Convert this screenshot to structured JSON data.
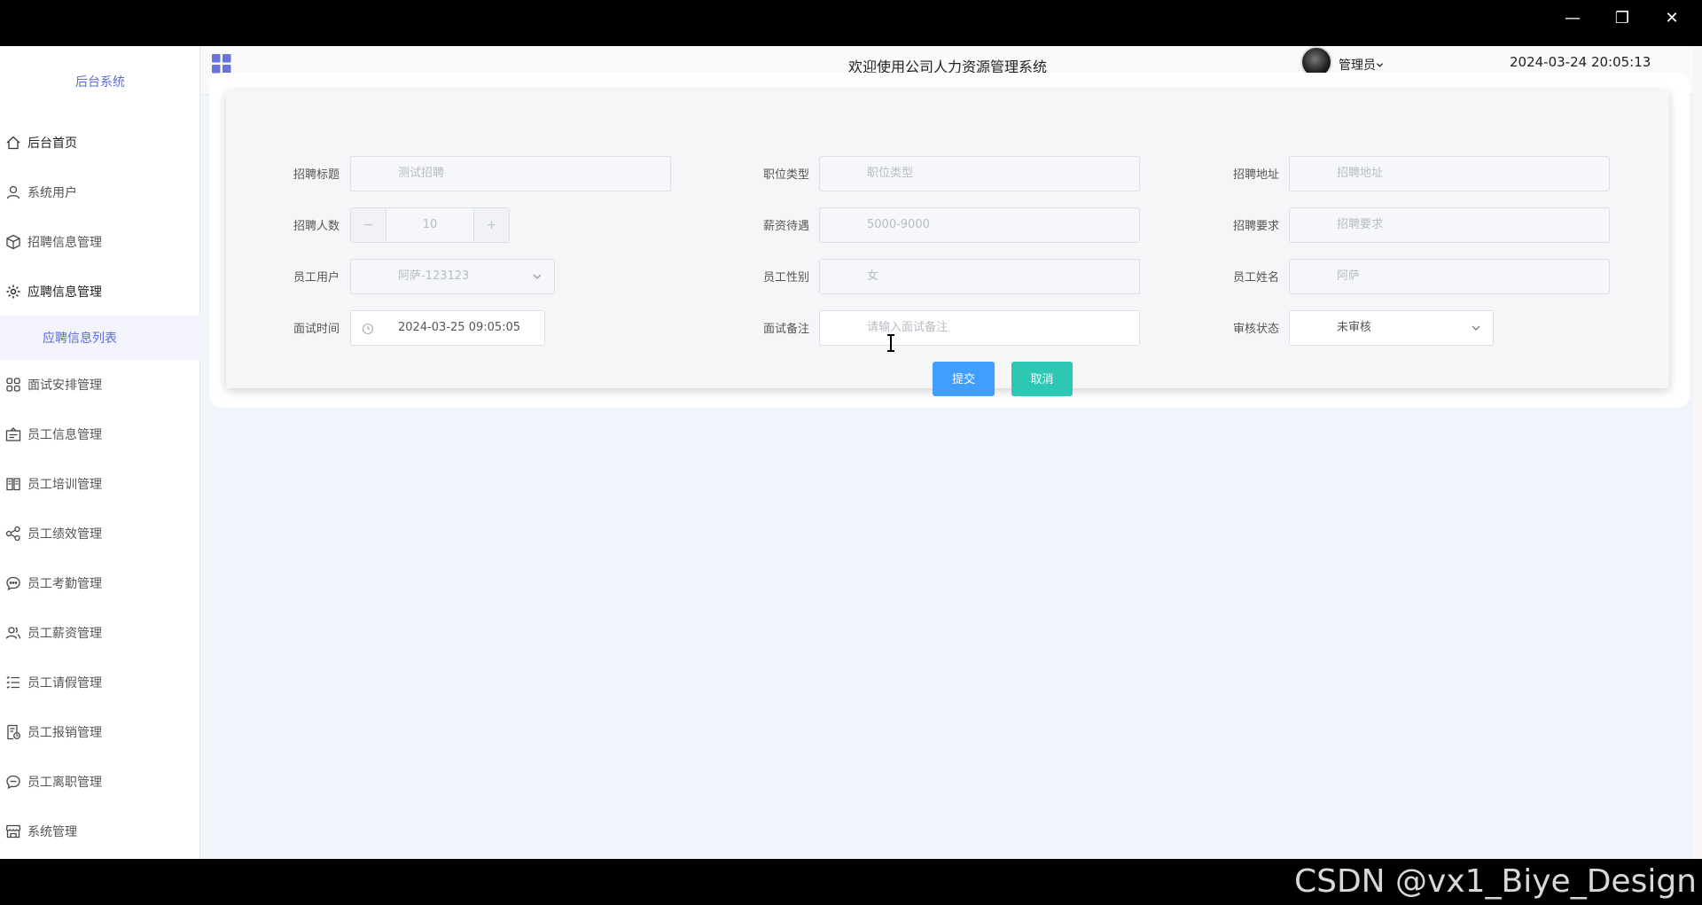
{
  "window": {
    "minimize": "—",
    "maximize": "❐",
    "close": "✕"
  },
  "sidebar": {
    "brand": "后台系统",
    "items": [
      {
        "label": "后台首页",
        "icon": "home-icon"
      },
      {
        "label": "系统用户",
        "icon": "user-icon"
      },
      {
        "label": "招聘信息管理",
        "icon": "box-icon"
      },
      {
        "label": "应聘信息管理",
        "icon": "gear-icon"
      },
      {
        "label": "面试安排管理",
        "icon": "grid-icon"
      },
      {
        "label": "员工信息管理",
        "icon": "id-card-icon"
      },
      {
        "label": "员工培训管理",
        "icon": "book-icon"
      },
      {
        "label": "员工绩效管理",
        "icon": "share-icon"
      },
      {
        "label": "员工考勤管理",
        "icon": "chat-icon"
      },
      {
        "label": "员工薪资管理",
        "icon": "users-icon"
      },
      {
        "label": "员工请假管理",
        "icon": "list-icon"
      },
      {
        "label": "员工报销管理",
        "icon": "receipt-icon"
      },
      {
        "label": "员工离职管理",
        "icon": "chat-dots-icon"
      },
      {
        "label": "系统管理",
        "icon": "shop-icon"
      }
    ],
    "submenu": {
      "label": "应聘信息列表"
    }
  },
  "header": {
    "title": "欢迎使用公司人力资源管理系统",
    "user": "管理员",
    "datetime": "2024-03-24 20:05:13"
  },
  "form": {
    "recruit_title": {
      "label": "招聘标题",
      "value": "测试招聘"
    },
    "position_type": {
      "label": "职位类型",
      "value": "职位类型"
    },
    "recruit_address": {
      "label": "招聘地址",
      "value": "招聘地址"
    },
    "headcount": {
      "label": "招聘人数",
      "value": "10",
      "minus": "−",
      "plus": "+"
    },
    "salary": {
      "label": "薪资待遇",
      "value": "5000-9000"
    },
    "requirements": {
      "label": "招聘要求",
      "value": "招聘要求"
    },
    "employee_user": {
      "label": "员工用户",
      "value": "阿萨-123123"
    },
    "gender": {
      "label": "员工性别",
      "value": "女"
    },
    "employee_name": {
      "label": "员工姓名",
      "value": "阿萨"
    },
    "interview_time": {
      "label": "面试时间",
      "value": "2024-03-25 09:05:05"
    },
    "interview_note": {
      "label": "面试备注",
      "placeholder": "请输入面试备注"
    },
    "review_status": {
      "label": "审核状态",
      "value": "未审核"
    },
    "submit": "提交",
    "cancel": "取消"
  },
  "watermark": "CSDN @vx1_Biye_Design",
  "colors": {
    "accent": "#409eff",
    "teal": "#2ec7b4",
    "brand": "#5b6bd8"
  }
}
